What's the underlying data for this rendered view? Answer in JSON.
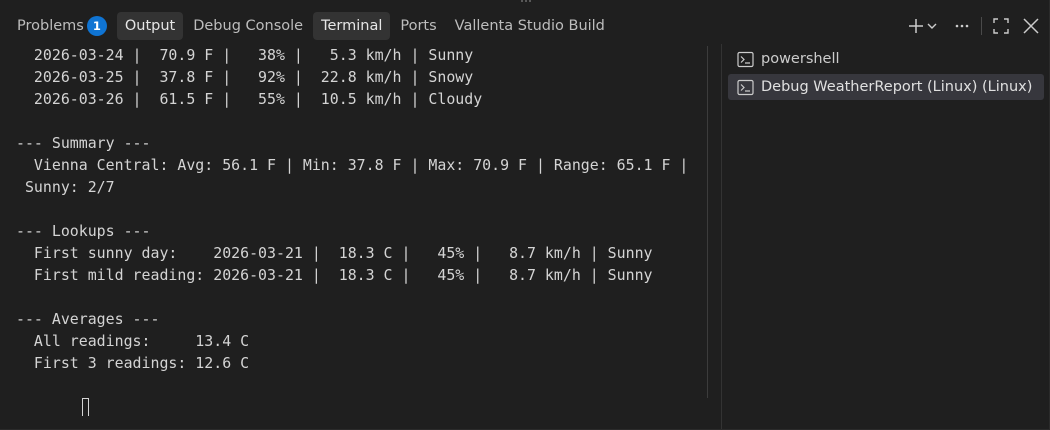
{
  "tabs": [
    {
      "label": "Problems",
      "badge": "1",
      "active": false
    },
    {
      "label": "Output",
      "active": true
    },
    {
      "label": "Debug Console",
      "active": false
    },
    {
      "label": "Terminal",
      "active": true
    },
    {
      "label": "Ports",
      "active": false
    },
    {
      "label": "Vallenta Studio Build",
      "active": false
    }
  ],
  "actions": [
    {
      "name": "new-terminal-icon"
    },
    {
      "name": "chevron-down-icon"
    },
    {
      "name": "more-actions-icon"
    },
    {
      "name": "maximize-panel-icon"
    },
    {
      "name": "close-icon"
    }
  ],
  "terminal": {
    "lines": [
      "  2026-03-24 |  70.9 F |   38% |   5.3 km/h | Sunny",
      "  2026-03-25 |  37.8 F |   92% |  22.8 km/h | Snowy",
      "  2026-03-26 |  61.5 F |   55% |  10.5 km/h | Cloudy",
      "",
      "--- Summary ---",
      "  Vienna Central: Avg: 56.1 F | Min: 37.8 F | Max: 70.9 F | Range: 65.1 F |",
      " Sunny: 2/7",
      "",
      "--- Lookups ---",
      "  First sunny day:    2026-03-21 |  18.3 C |   45% |   8.7 km/h | Sunny",
      "  First mild reading: 2026-03-21 |  18.3 C |   45% |   8.7 km/h | Sunny",
      "",
      "--- Averages ---",
      "  All readings:     13.4 C",
      "  First 3 readings: 12.6 C"
    ]
  },
  "terminal_list": [
    {
      "label": "powershell",
      "icon": "terminal-icon",
      "selected": false
    },
    {
      "label": "Debug WeatherReport (Linux) (Linux)",
      "icon": "terminal-icon",
      "selected": true
    }
  ],
  "colors": {
    "background": "#1f1f1f",
    "active_tab": "#333333",
    "badge": "#0f74d3",
    "text": "#d4d4d4",
    "selected_item": "#37373d"
  }
}
